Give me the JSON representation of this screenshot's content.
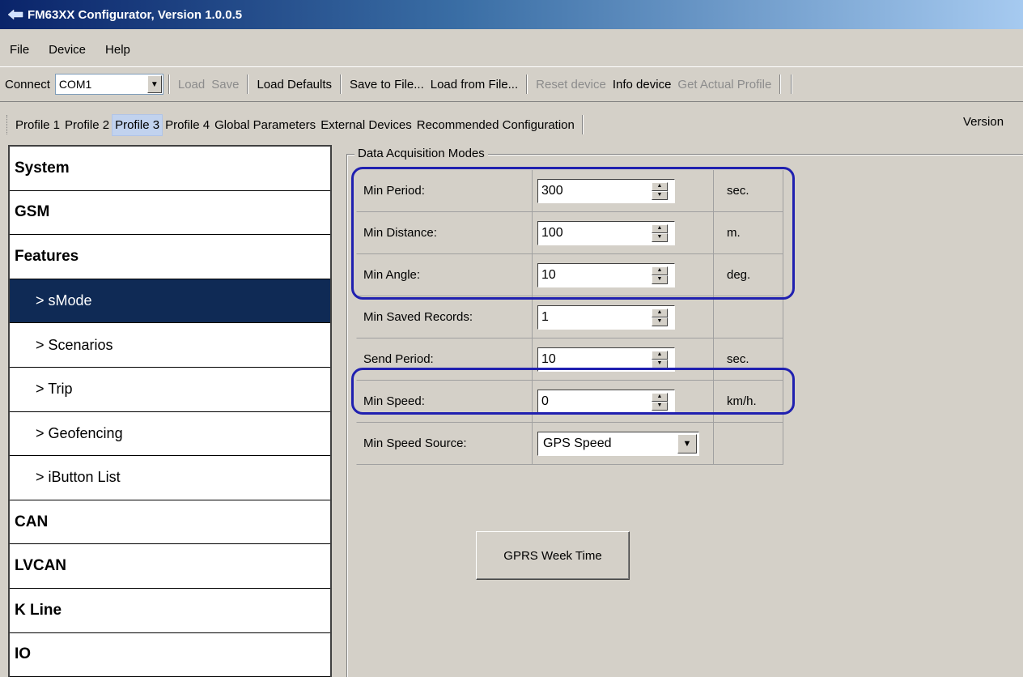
{
  "window": {
    "title": "FM63XX Configurator, Version 1.0.0.5",
    "app_icon": "app-logo-icon"
  },
  "menu": [
    "File",
    "Device",
    "Help"
  ],
  "toolbar": {
    "connect_label": "Connect",
    "port_value": "COM1",
    "load": "Load",
    "save": "Save",
    "load_defaults": "Load Defaults",
    "save_to_file": "Save to File...",
    "load_from_file": "Load from File...",
    "reset_device": "Reset device",
    "info_device": "Info device",
    "get_actual_profile": "Get Actual Profile"
  },
  "profiles": {
    "tabs": [
      "Profile 1",
      "Profile 2",
      "Profile 3",
      "Profile 4",
      "Global Parameters",
      "External Devices",
      "Recommended Configuration"
    ],
    "active": "Profile 3",
    "version_label": "Version"
  },
  "nav": [
    {
      "label": "System",
      "level": "top"
    },
    {
      "label": "GSM",
      "level": "top"
    },
    {
      "label": "Features",
      "level": "top"
    },
    {
      "label": "> sMode",
      "level": "sub",
      "selected": true
    },
    {
      "label": "> Scenarios",
      "level": "sub"
    },
    {
      "label": "> Trip",
      "level": "sub"
    },
    {
      "label": "> Geofencing",
      "level": "sub"
    },
    {
      "label": "> iButton List",
      "level": "sub"
    },
    {
      "label": "CAN",
      "level": "top"
    },
    {
      "label": "LVCAN",
      "level": "top"
    },
    {
      "label": "K Line",
      "level": "top"
    },
    {
      "label": "IO",
      "level": "top"
    }
  ],
  "panel": {
    "group_title": "Data Acquisition Modes",
    "rows": [
      {
        "label": "Min Period:",
        "value": "300",
        "unit": "sec."
      },
      {
        "label": "Min Distance:",
        "value": "100",
        "unit": "m."
      },
      {
        "label": "Min Angle:",
        "value": "10",
        "unit": "deg."
      },
      {
        "label": "Min Saved Records:",
        "value": "1",
        "unit": ""
      },
      {
        "label": "Send Period:",
        "value": "10",
        "unit": "sec."
      },
      {
        "label": "Min Speed:",
        "value": "0",
        "unit": "km/h."
      }
    ],
    "source_row": {
      "label": "Min Speed Source:",
      "value": "GPS Speed"
    },
    "gprs_button": "GPRS Week Time"
  },
  "colors": {
    "highlight": "#2020b0",
    "nav_selected": "#0f2a55",
    "title_gradient_start": "#0a246a"
  }
}
